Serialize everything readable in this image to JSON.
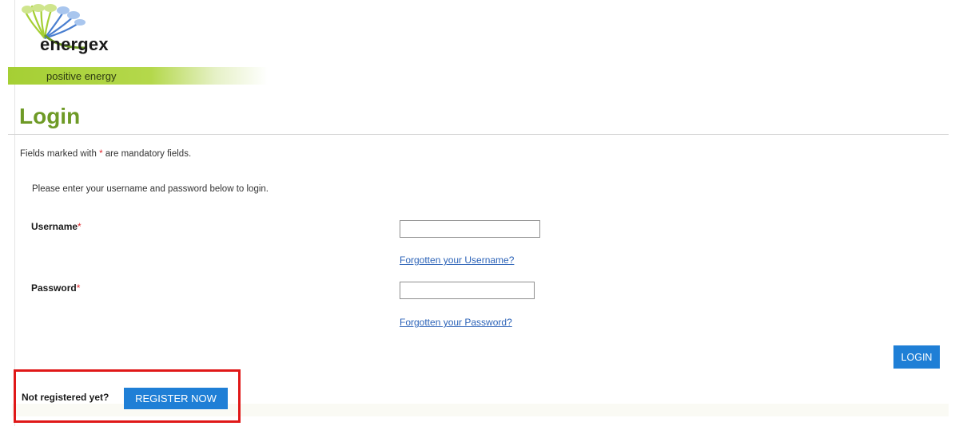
{
  "brand": {
    "name": "energex",
    "tagline": "positive energy",
    "colors": {
      "green": "#6e9a26",
      "lime": "#a5cf34",
      "blue": "#1f7fd6"
    }
  },
  "page": {
    "title": "Login",
    "mandatory_prefix": "Fields marked with",
    "mandatory_star": "*",
    "mandatory_suffix": "are mandatory fields.",
    "intro": "Please enter your username and password below to login."
  },
  "form": {
    "username_label": "Username",
    "password_label": "Password",
    "required_mark": "*",
    "username_value": "",
    "password_value": "",
    "forgot_username": "Forgotten your Username?",
    "forgot_password": "Forgotten your Password?",
    "login_button": "LOGIN"
  },
  "register": {
    "prompt": "Not registered yet?",
    "button": "REGISTER NOW",
    "highlight_color": "#e01818"
  }
}
